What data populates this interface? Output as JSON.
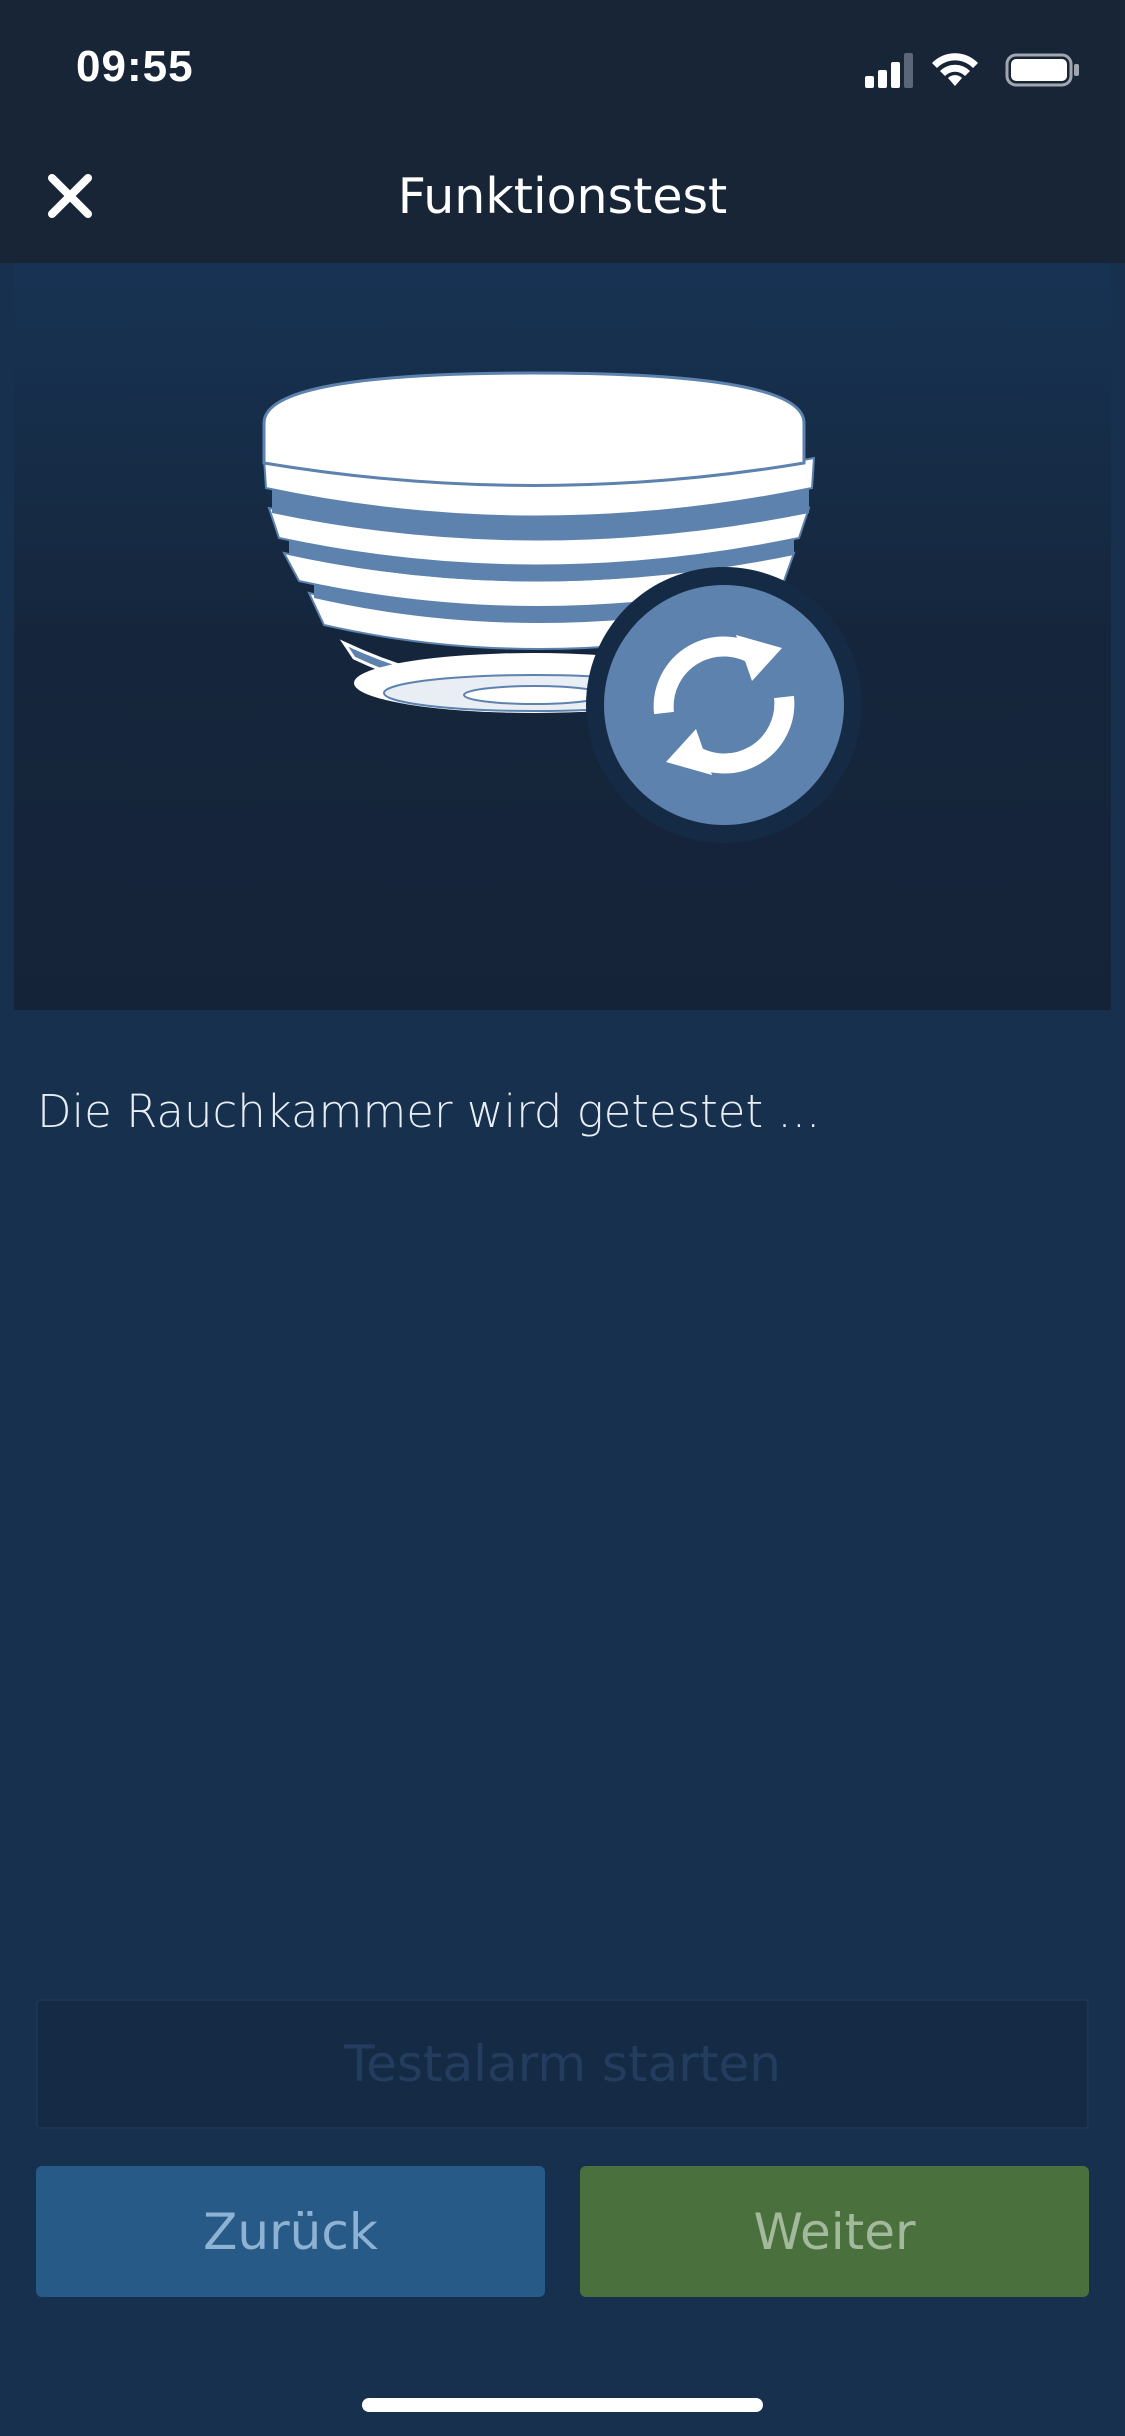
{
  "status_bar": {
    "time": "09:55",
    "icons": [
      "signal-icon",
      "wifi-icon",
      "battery-icon"
    ]
  },
  "nav": {
    "close_icon": "close-icon",
    "title": "Funktionstest"
  },
  "illustration": {
    "subject": "smoke-detector-icon",
    "badge": "refresh-icon"
  },
  "content": {
    "status_text": "Die Rauchkammer wird getestet ..."
  },
  "buttons": {
    "test_alarm": "Testalarm starten",
    "back": "Zurück",
    "next": "Weiter"
  },
  "colors": {
    "background": "#17304d",
    "topbar": "#172537",
    "back_button": "#275a87",
    "next_button": "#4a703e",
    "detector_blue": "#5d82ad"
  }
}
